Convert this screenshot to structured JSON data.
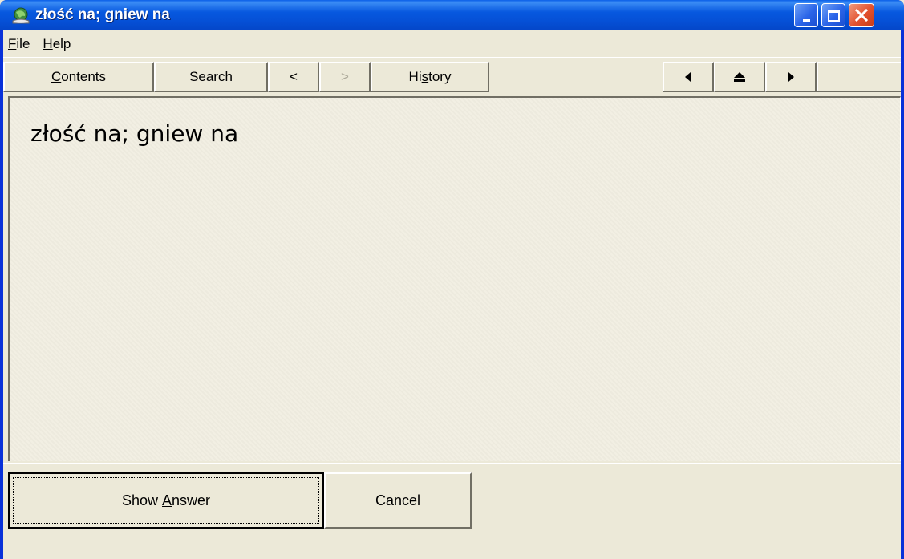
{
  "window": {
    "title": "złość na; gniew na",
    "app_icon": "globe-icon"
  },
  "caption_buttons": {
    "minimize_icon": "minimize-icon",
    "maximize_icon": "maximize-icon",
    "close_icon": "close-icon"
  },
  "menu": {
    "file": {
      "pre": "",
      "accel": "F",
      "post": "ile"
    },
    "help": {
      "pre": "",
      "accel": "H",
      "post": "elp"
    }
  },
  "toolbar": {
    "contents": {
      "pre": "",
      "accel": "C",
      "post": "ontents"
    },
    "search": "Search",
    "back": "<",
    "forward": ">",
    "history": {
      "pre": "Hi",
      "accel": "s",
      "post": "tory"
    },
    "prev_icon": "triangle-left-icon",
    "up_icon": "triangle-up-icon",
    "next_icon": "triangle-right-icon"
  },
  "content": {
    "text": "złość na; gniew na"
  },
  "buttons": {
    "show_answer": {
      "pre": "Show ",
      "accel": "A",
      "post": "nswer"
    },
    "cancel": "Cancel"
  },
  "colors": {
    "titlebar": "#0550d6",
    "face": "#ece9d8",
    "close_button": "#e2512e"
  }
}
